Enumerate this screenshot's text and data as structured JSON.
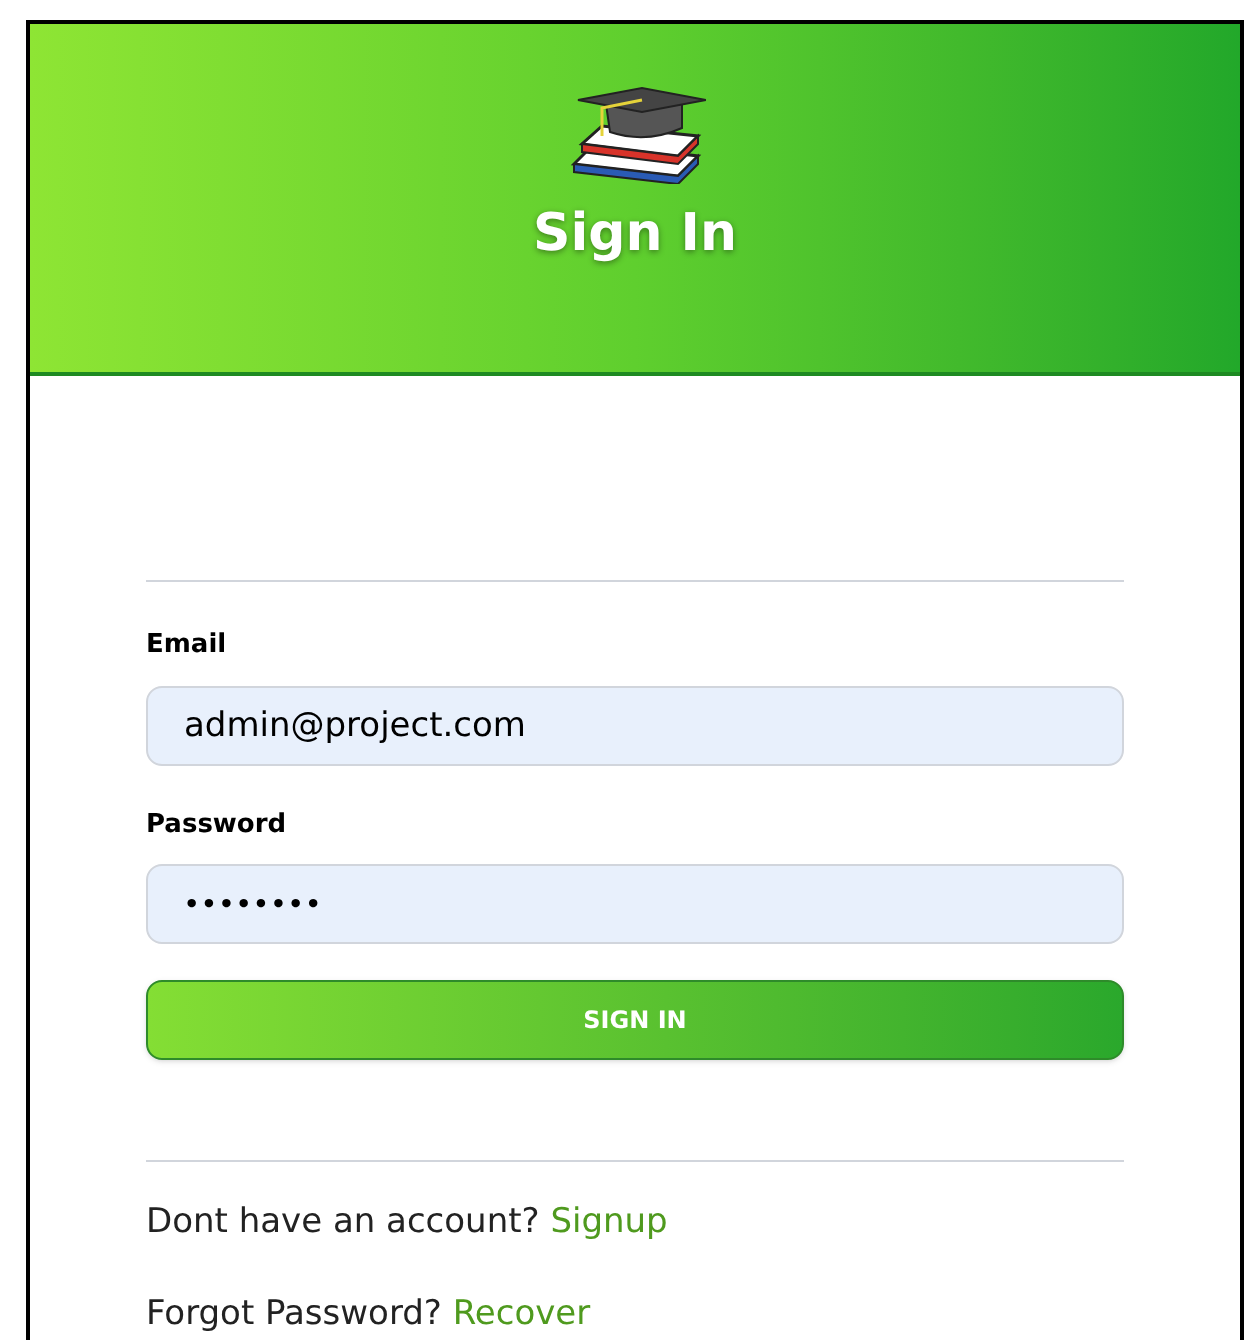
{
  "header": {
    "title": "Sign In"
  },
  "form": {
    "fields": [
      {
        "label": "Email",
        "value": "admin@project.com",
        "kind": "text"
      },
      {
        "label": "Password",
        "value": "••••••••",
        "kind": "password"
      }
    ],
    "submit": "SIGN IN"
  },
  "footer_links": [
    {
      "text": "Dont have an account?",
      "link": "Signup"
    },
    {
      "text": "Forgot Password?",
      "link": "Recover"
    }
  ]
}
